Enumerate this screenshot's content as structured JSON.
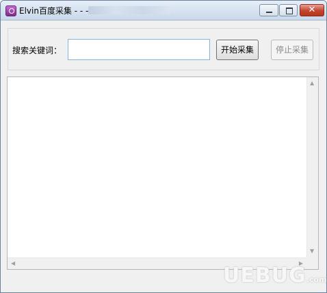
{
  "window": {
    "title": "Elvin百度采集 - - -",
    "minimize": "minimize",
    "maximize": "maximize",
    "close": "✕"
  },
  "search": {
    "label": "搜索关键词：",
    "value": "",
    "placeholder": ""
  },
  "buttons": {
    "start": "开始采集",
    "stop": "停止采集"
  },
  "output": {
    "text": ""
  },
  "icons": {
    "app": "app-icon",
    "scroll_up": "▲",
    "scroll_down": "▼",
    "scroll_left": "◀",
    "scroll_right": "▶"
  },
  "watermark": {
    "text": "UEBUG",
    "suffix": ".com"
  }
}
